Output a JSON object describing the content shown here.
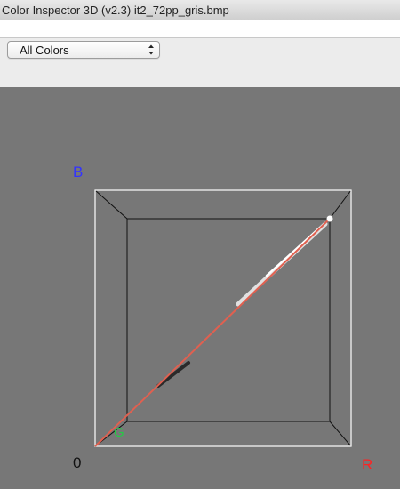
{
  "window": {
    "title": "Color Inspector 3D (v2.3)    it2_72pp_gris.bmp"
  },
  "toolbar": {
    "color_mode_selected": "All Colors"
  },
  "axes": {
    "blue_label": "B",
    "green_label": "G",
    "red_label": "R",
    "origin_label": "0"
  },
  "colors": {
    "blue_axis": "#3333ff",
    "green_axis": "#22cc44",
    "red_axis": "#ff2222",
    "gray_line": "#e06050"
  }
}
